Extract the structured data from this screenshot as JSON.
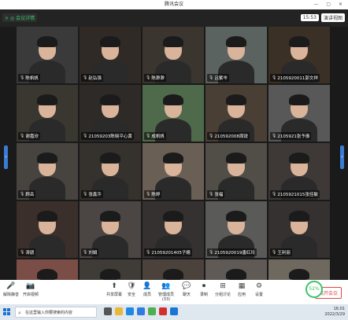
{
  "window": {
    "title": "腾讯会议"
  },
  "infobar": {
    "left_pill": "× ◎ 会议详情",
    "time": "15:53",
    "view": "演讲视图"
  },
  "tiles": [
    {
      "label": "陈帆帆",
      "highlight": true,
      "bg": "#3a3a3a"
    },
    {
      "label": "赵弘强",
      "bg": "#2f2a26"
    },
    {
      "label": "陈渺渺",
      "bg": "#3b3530"
    },
    {
      "label": "吕紫岑",
      "bg": "#5b6360"
    },
    {
      "label": "2105920011郭文祥",
      "bg": "#3a3026"
    },
    {
      "label": "谢嘉欣",
      "bg": "#3a3630"
    },
    {
      "label": "21059203陈晓平心黄",
      "bg": "#2d2a28"
    },
    {
      "label": "成帆帆",
      "bg": "#4f6a4b"
    },
    {
      "label": "210592008周锐",
      "bg": "#4a3f34"
    },
    {
      "label": "2105921张予振",
      "bg": "#585858"
    },
    {
      "label": "顾岳",
      "bg": "#47443f"
    },
    {
      "label": "张鑫汼",
      "bg": "#35312c"
    },
    {
      "label": "陈婷",
      "bg": "#6a5f55"
    },
    {
      "label": "张福",
      "bg": "#514d47"
    },
    {
      "label": "2105921015张佳敏",
      "bg": "#3e3936"
    },
    {
      "label": "涛骁",
      "bg": "#3a2f2a"
    },
    {
      "label": "刘娟",
      "bg": "#4b4644"
    },
    {
      "label": "21059201405子嬉",
      "bg": "#353131"
    },
    {
      "label": "2105920019唐红玲",
      "bg": "#5a5a58"
    },
    {
      "label": "王利丽",
      "bg": "#343130"
    },
    {
      "label": "",
      "bg": "#7a4e46"
    },
    {
      "label": "",
      "bg": "#3f3b37"
    },
    {
      "label": "",
      "bg": "#4a423b"
    },
    {
      "label": "",
      "bg": "#5f5a55"
    },
    {
      "label": "",
      "bg": "#6e685f"
    }
  ],
  "toolbar": {
    "mute": "解除静音",
    "video": "开启视频",
    "share": "共享屏幕",
    "security": "安全",
    "members": "成员",
    "manage": "管理成员(33)",
    "chat": "聊天",
    "record": "录制",
    "rooms": "分组讨论",
    "apps": "应用",
    "settings": "设置",
    "leave": "离开会议",
    "percent": "52%"
  },
  "taskbar": {
    "search_placeholder": "在这里输入你要搜索的内容",
    "time": "16:01",
    "date": "2022/3/29"
  }
}
